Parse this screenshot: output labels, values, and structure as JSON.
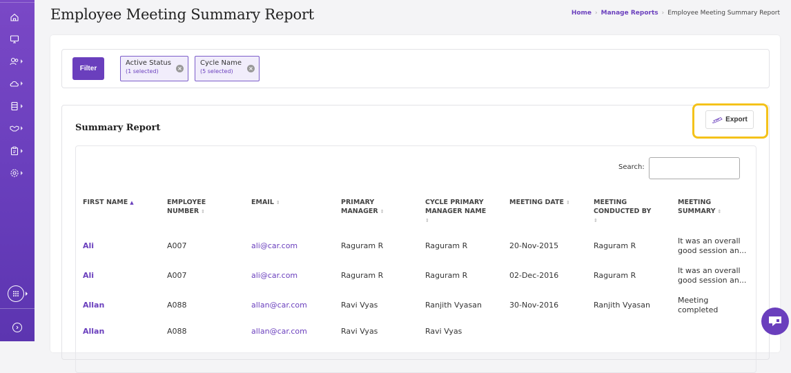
{
  "header": {
    "title": "Employee Meeting Summary Report",
    "breadcrumb": [
      "Home",
      "Manage Reports",
      "Employee Meeting Summary Report"
    ]
  },
  "filters": {
    "button_label": "Filter",
    "chips": [
      {
        "title": "Active Status",
        "sub": "(1 selected)"
      },
      {
        "title": "Cycle Name",
        "sub": "(5 selected)"
      }
    ]
  },
  "report": {
    "title": "Summary Report",
    "export_label": "Export",
    "search_label": "Search:",
    "search_value": ""
  },
  "table": {
    "columns": [
      {
        "line1": "FIRST NAME",
        "line2": ""
      },
      {
        "line1": "EMPLOYEE",
        "line2": "NUMBER"
      },
      {
        "line1": "EMAIL",
        "line2": ""
      },
      {
        "line1": "PRIMARY",
        "line2": "MANAGER"
      },
      {
        "line1": "CYCLE PRIMARY",
        "line2": "MANAGER NAME"
      },
      {
        "line1": "MEETING DATE",
        "line2": ""
      },
      {
        "line1": "MEETING",
        "line2": "CONDUCTED BY"
      },
      {
        "line1": "MEETING",
        "line2": "SUMMARY"
      }
    ],
    "rows": [
      {
        "first_name": "Ali",
        "employee_number": "A007",
        "email": "ali@car.com",
        "primary_manager": "Raguram R",
        "cycle_primary_manager": "Raguram R",
        "meeting_date": "20-Nov-2015",
        "conducted_by": "Raguram R",
        "summary_1": "It was an overall",
        "summary_2": "good session an..."
      },
      {
        "first_name": "Ali",
        "employee_number": "A007",
        "email": "ali@car.com",
        "primary_manager": "Raguram R",
        "cycle_primary_manager": "Raguram R",
        "meeting_date": "02-Dec-2016",
        "conducted_by": "Raguram R",
        "summary_1": "It was an overall",
        "summary_2": "good session an..."
      },
      {
        "first_name": "Allan",
        "employee_number": "A088",
        "email": "allan@car.com",
        "primary_manager": "Ravi Vyas",
        "cycle_primary_manager": "Ranjith Vyasan",
        "meeting_date": "30-Nov-2016",
        "conducted_by": "Ranjith Vyasan",
        "summary_1": "Meeting",
        "summary_2": "completed"
      },
      {
        "first_name": "Allan",
        "employee_number": "A088",
        "email": "allan@car.com",
        "primary_manager": "Ravi Vyas",
        "cycle_primary_manager": "Ravi Vyas",
        "meeting_date": "",
        "conducted_by": "",
        "summary_1": "",
        "summary_2": ""
      }
    ]
  },
  "sidebar": {
    "icons": [
      "home-icon",
      "desktop-icon",
      "users-icon",
      "cloud-icon",
      "database-icon",
      "handshake-icon",
      "clipboard-icon",
      "settings-icon",
      "apps-grid-icon",
      "arrow-right-circle-icon"
    ]
  },
  "colors": {
    "brand": "#6a3fbd",
    "highlight": "#f4c21a"
  }
}
